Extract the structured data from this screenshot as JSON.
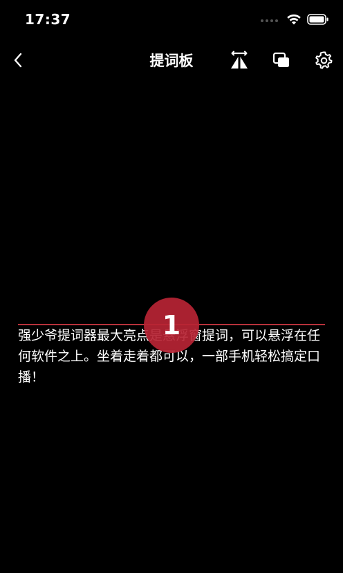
{
  "status_bar": {
    "time": "17:37"
  },
  "nav": {
    "title": "提词板",
    "back_icon": "chevron-left-icon",
    "mirror_icon": "mirror-flip-icon",
    "float_icon": "floating-window-icon",
    "settings_icon": "gear-icon"
  },
  "prompter": {
    "countdown": "1",
    "script": "强少爷提词器最大亮点是悬浮窗提词，可以悬浮在任何软件之上。坐着走着都可以，一部手机轻松搞定口播！",
    "guide_line_color": "#b7313b",
    "countdown_color": "#b72434"
  },
  "colors": {
    "background": "#000000",
    "text": "#ffffff"
  }
}
